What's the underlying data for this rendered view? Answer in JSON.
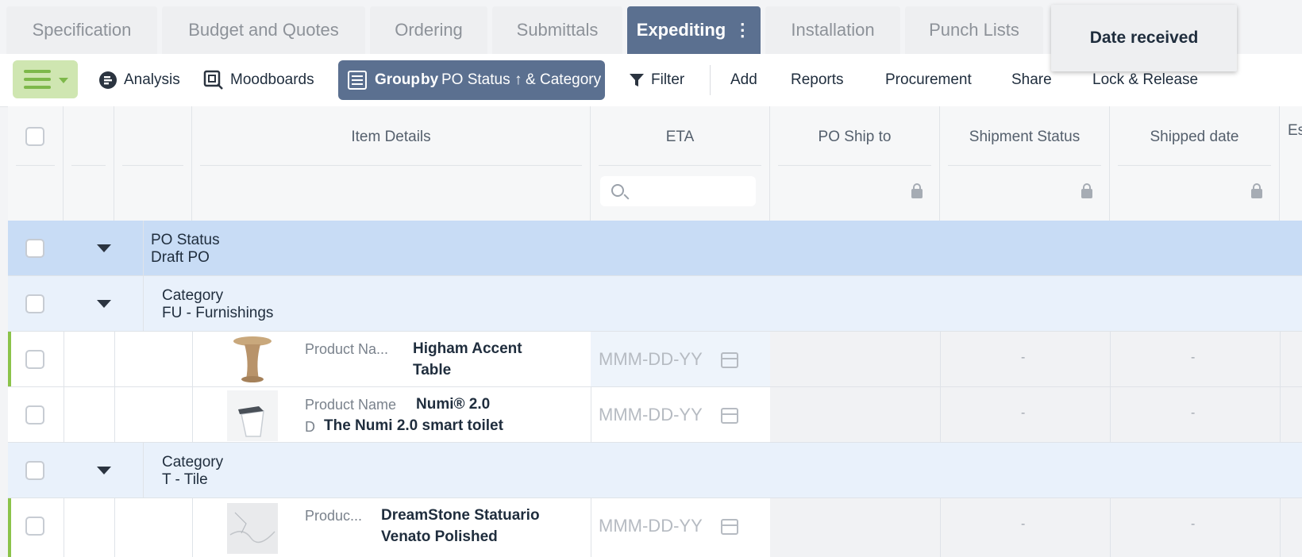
{
  "tabs": [
    {
      "label": "Specification"
    },
    {
      "label": "Budget and Quotes"
    },
    {
      "label": "Ordering"
    },
    {
      "label": "Submittals"
    },
    {
      "label": "Expediting",
      "active": true
    },
    {
      "label": "Installation"
    },
    {
      "label": "Punch Lists"
    }
  ],
  "tooltip": "Date received",
  "toolbar": {
    "analysis": "Analysis",
    "moodboards": "Moodboards",
    "group_prefix": "Group",
    "group_by": "by",
    "group_field1": "PO Status",
    "group_amp": "&",
    "group_field2": "Category",
    "filter": "Filter",
    "add": "Add",
    "reports": "Reports",
    "procurement": "Procurement",
    "share": "Share",
    "lock_release": "Lock & Release"
  },
  "columns": {
    "item_details": "Item Details",
    "eta": "ETA",
    "po_ship_to": "PO Ship to",
    "shipment_status": "Shipment Status",
    "shipped_date": "Shipped date",
    "next": "Est"
  },
  "groups": {
    "po_status_label": "PO Status",
    "po_status_value": "Draft PO",
    "cat1_label": "Category",
    "cat1_value": "FU - Furnishings",
    "cat2_label": "Category",
    "cat2_value": "T - Tile"
  },
  "items": [
    {
      "label": "Product Na...",
      "name_line1": "Higham Accent",
      "name_line2": "Table",
      "date_placeholder": "MMM-DD-YY",
      "dash": "-"
    },
    {
      "label": "Product Name",
      "name_line1": "Numi® 2.0",
      "label2": "D",
      "name_line2": "The Numi 2.0 smart toilet",
      "date_placeholder": "MMM-DD-YY",
      "dash": "-"
    },
    {
      "label": "Produc...",
      "name_line1": "DreamStone Statuario",
      "name_line2": "Venato Polished",
      "date_placeholder": "MMM-DD-YY",
      "dash": "-"
    }
  ],
  "colors": {
    "accent": "#5b7090",
    "green": "#8bc34a",
    "group_blue": "#c8dcf5"
  }
}
